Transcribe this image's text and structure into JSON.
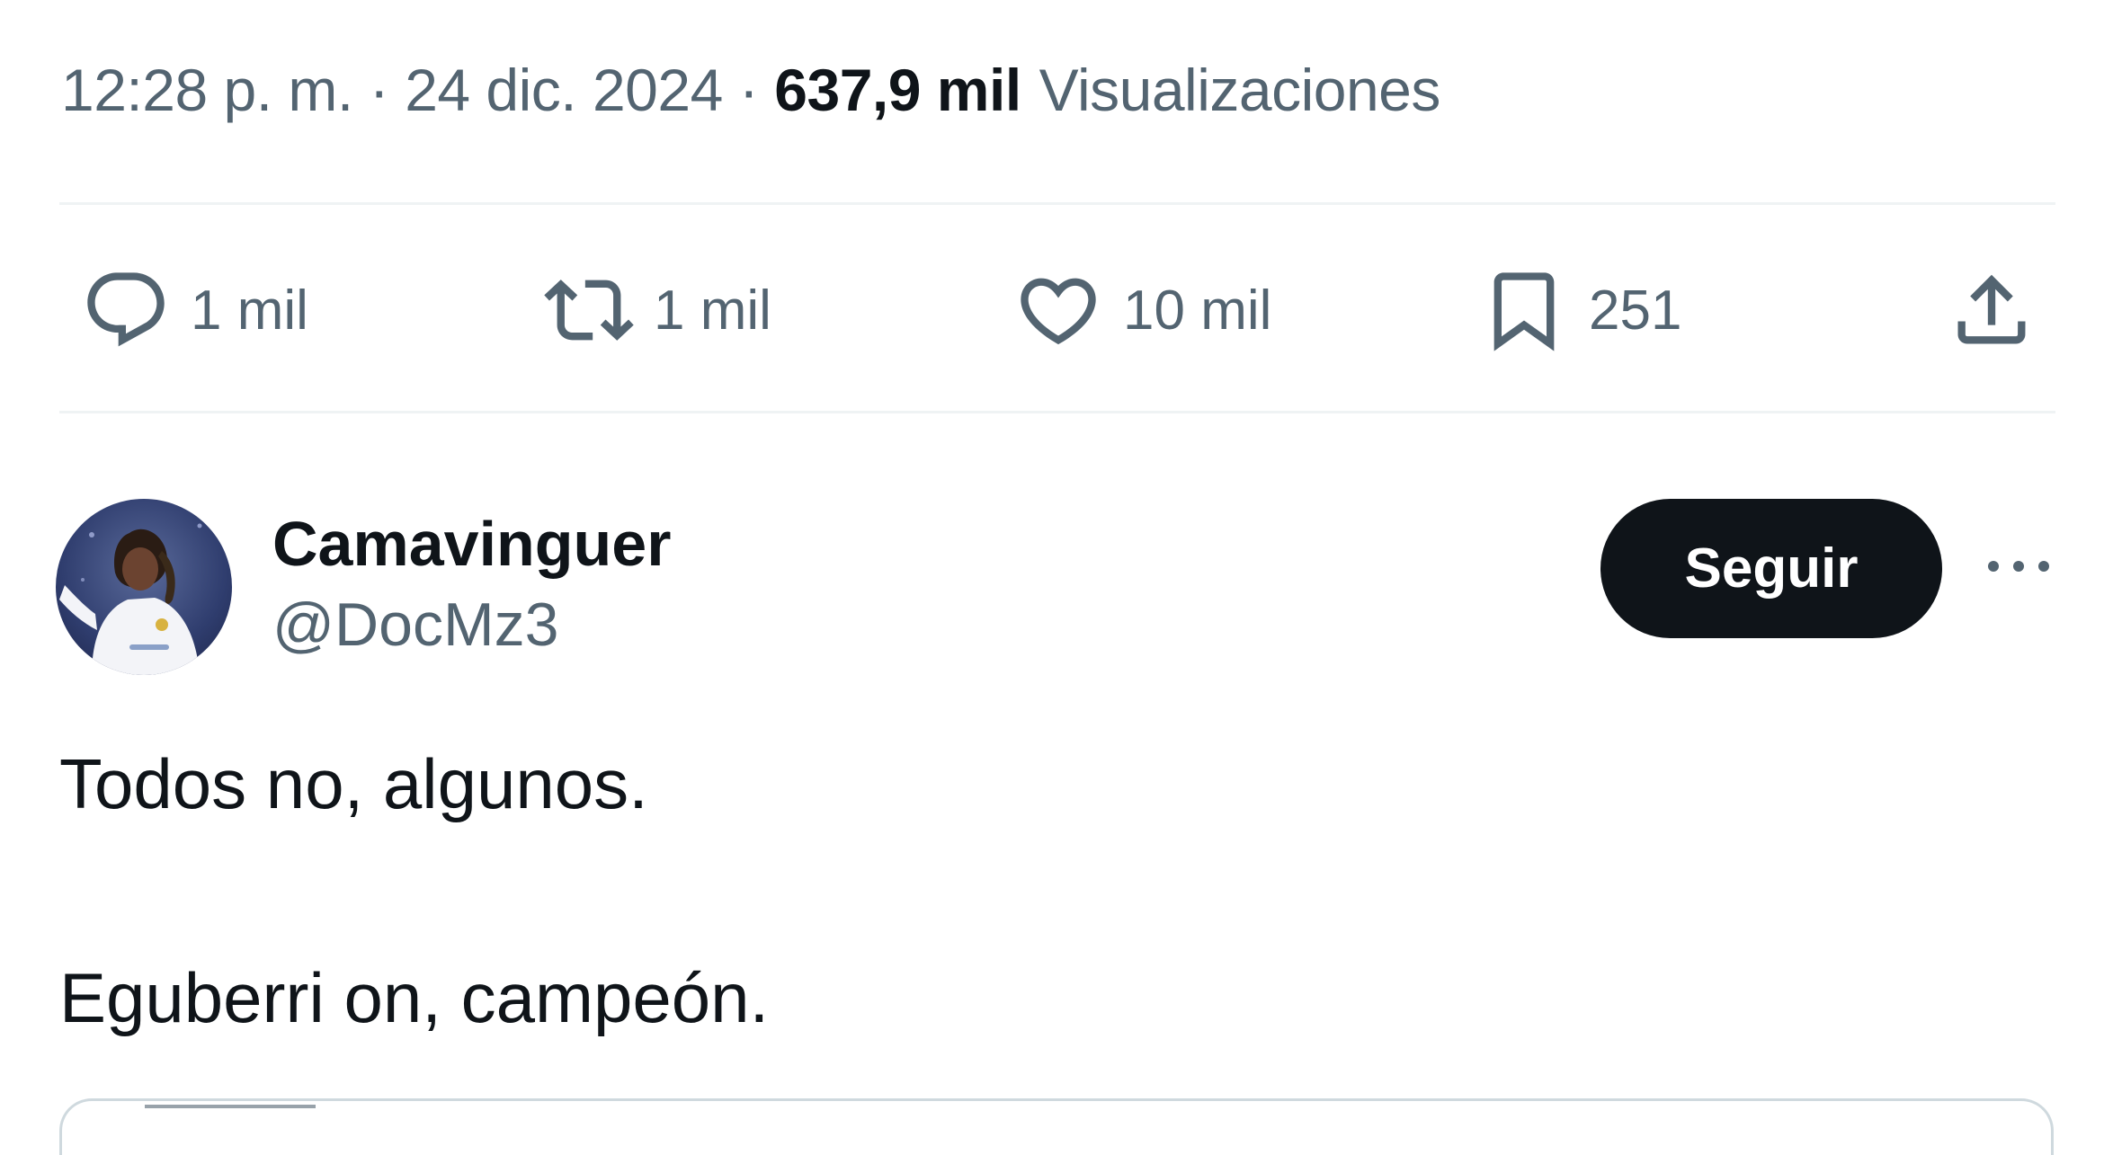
{
  "meta": {
    "time": "12:28 p. m.",
    "separator": "·",
    "date": "24 dic. 2024",
    "views_count": "637,9 mil",
    "views_label": "Visualizaciones"
  },
  "actions": {
    "reply_count": "1 mil",
    "retweet_count": "1 mil",
    "like_count": "10 mil",
    "bookmark_count": "251"
  },
  "user": {
    "display_name": "Camavinguer",
    "handle": "@DocMz3",
    "follow_label": "Seguir"
  },
  "tweet": {
    "line1": "Todos no, algunos.",
    "line2": "Eguberri on, campeón."
  },
  "icons": {
    "reply": "reply-bubble-icon",
    "retweet": "retweet-icon",
    "like": "heart-icon",
    "bookmark": "bookmark-icon",
    "share": "share-upload-icon",
    "more": "more-dots-icon"
  },
  "colors": {
    "text_primary": "#0f1419",
    "text_secondary": "#536471",
    "divider": "#eff3f4",
    "button_bg": "#0f1419",
    "button_text": "#ffffff"
  }
}
